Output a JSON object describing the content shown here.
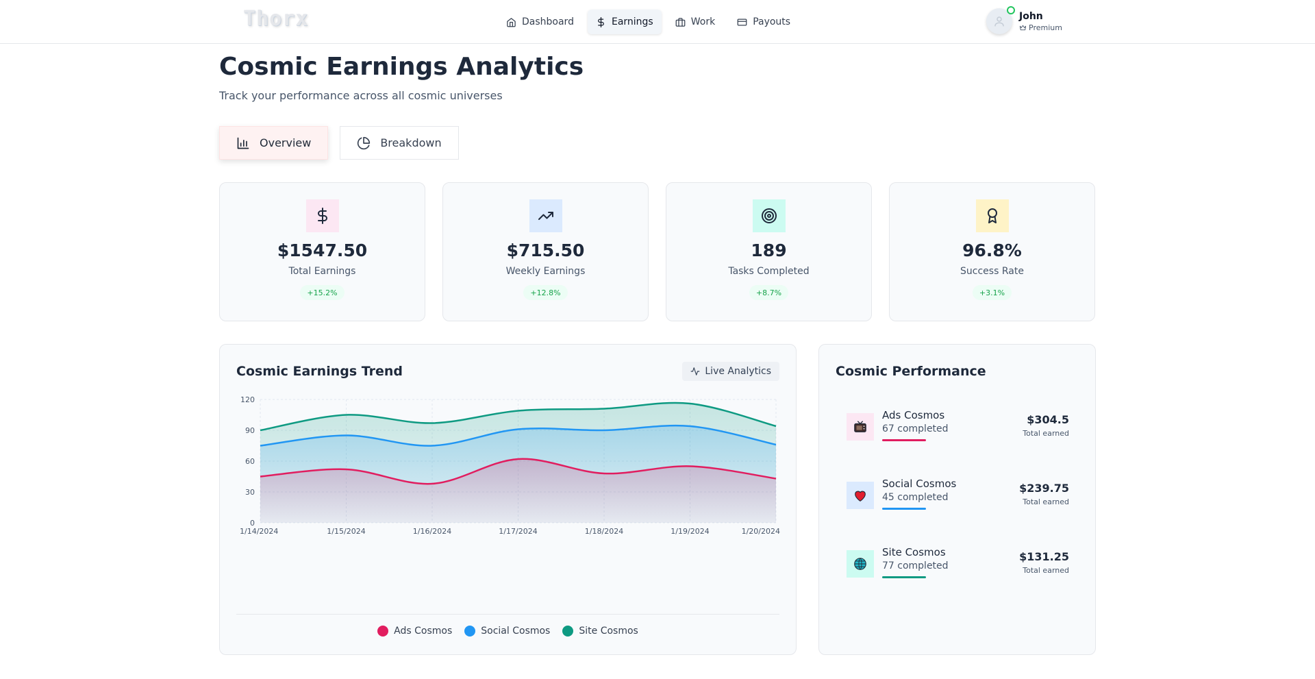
{
  "nav": {
    "logo": "Thorx",
    "items": [
      {
        "label": "Dashboard",
        "icon": "home-icon"
      },
      {
        "label": "Earnings",
        "icon": "dollar-icon"
      },
      {
        "label": "Work",
        "icon": "briefcase-icon"
      },
      {
        "label": "Payouts",
        "icon": "credit-card-icon"
      }
    ],
    "active": "Earnings",
    "user": {
      "name": "John",
      "tier": "Premium"
    }
  },
  "header": {
    "title": "Cosmic Earnings Analytics",
    "subtitle": "Track your performance across all cosmic universes"
  },
  "tabs": [
    {
      "label": "Overview",
      "icon": "bar-chart-icon"
    },
    {
      "label": "Breakdown",
      "icon": "pie-chart-icon"
    }
  ],
  "stats": [
    {
      "value": "$1547.50",
      "label": "Total Earnings",
      "change": "+15.2%",
      "icon": "dollar-icon",
      "bg": "#fce7f3"
    },
    {
      "value": "$715.50",
      "label": "Weekly Earnings",
      "change": "+12.8%",
      "icon": "trending-up-icon",
      "bg": "#dbeafe"
    },
    {
      "value": "189",
      "label": "Tasks Completed",
      "change": "+8.7%",
      "icon": "target-icon",
      "bg": "#ccfbf1"
    },
    {
      "value": "96.8%",
      "label": "Success Rate",
      "change": "+3.1%",
      "icon": "award-icon",
      "bg": "#fef3c7"
    }
  ],
  "trend": {
    "title": "Cosmic Earnings Trend",
    "badge": "Live Analytics"
  },
  "chart_data": {
    "type": "area",
    "categories": [
      "1/14/2024",
      "1/15/2024",
      "1/16/2024",
      "1/17/2024",
      "1/18/2024",
      "1/19/2024",
      "1/20/2024"
    ],
    "yticks": [
      "0",
      "30",
      "60",
      "90",
      "120"
    ],
    "ylim": [
      0,
      120
    ],
    "stacked": true,
    "grid": true,
    "legend": "bottom",
    "series": [
      {
        "name": "Ads Cosmos",
        "color": "#e11d5f",
        "values": [
          45,
          52,
          38,
          62,
          48,
          55,
          43
        ]
      },
      {
        "name": "Social Cosmos",
        "color": "#2196f3",
        "values": [
          75,
          85,
          75,
          91,
          90,
          94,
          76
        ]
      },
      {
        "name": "Site Cosmos",
        "color": "#0e9a82",
        "values": [
          90,
          105,
          97,
          109,
          111,
          116,
          94
        ]
      }
    ]
  },
  "performance": {
    "title": "Cosmic Performance",
    "items": [
      {
        "name": "Ads Cosmos",
        "completed": "67 completed",
        "amount": "$304.5",
        "sub": "Total earned",
        "color": "#e11d5f",
        "bg": "#fce7f3",
        "icon": "tv-icon"
      },
      {
        "name": "Social Cosmos",
        "completed": "45 completed",
        "amount": "$239.75",
        "sub": "Total earned",
        "color": "#2196f3",
        "bg": "#dbeafe",
        "icon": "heart-icon"
      },
      {
        "name": "Site Cosmos",
        "completed": "77 completed",
        "amount": "$131.25",
        "sub": "Total earned",
        "color": "#0e9a82",
        "bg": "#ccfbf1",
        "icon": "globe-icon"
      }
    ]
  }
}
